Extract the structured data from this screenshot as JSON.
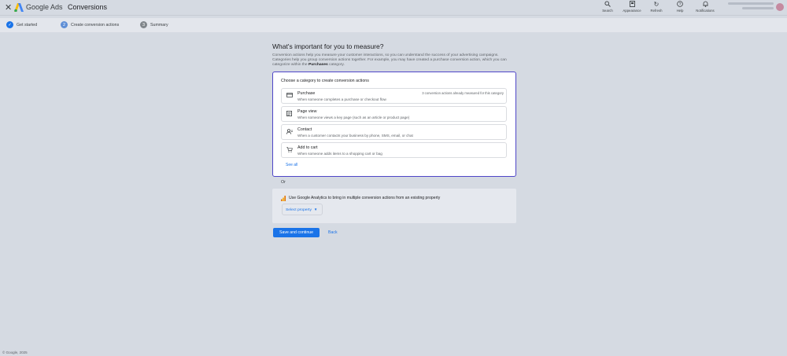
{
  "header": {
    "close_icon": "close-icon",
    "brand": "Google Ads",
    "page_title": "Conversions",
    "tools": [
      {
        "icon": "search-icon",
        "label": "Search"
      },
      {
        "icon": "appearance-icon",
        "label": "Appearance"
      },
      {
        "icon": "refresh-icon",
        "label": "Refresh"
      },
      {
        "icon": "help-icon",
        "label": "Help"
      },
      {
        "icon": "bell-icon",
        "label": "Notifications"
      }
    ]
  },
  "stepper": {
    "steps": [
      {
        "number": "✓",
        "label": "Get started",
        "state": "done"
      },
      {
        "number": "2",
        "label": "Create conversion actions",
        "state": "active"
      },
      {
        "number": "3",
        "label": "Summary",
        "state": "todo"
      }
    ]
  },
  "main": {
    "title": "What's important for you to measure?",
    "desc_part1": "Conversion actions help you measure your customer interactions, so you can understand the success of your advertising campaigns. Categories help you group conversion actions together. For example, you may have created a purchase conversion action, which you can categorize within the ",
    "desc_bold": "Purchases",
    "desc_part2": " category."
  },
  "category_card": {
    "title": "Choose a category to create conversion actions",
    "options": [
      {
        "icon": "credit-card-icon",
        "name": "Purchase",
        "desc": "When someone completes a purchase or checkout flow",
        "note": "3 conversion actions already measured for this category"
      },
      {
        "icon": "page-view-icon",
        "name": "Page view",
        "desc": "When someone views a key page (such as an article or product page)",
        "note": ""
      },
      {
        "icon": "contact-icon",
        "name": "Contact",
        "desc": "When a customer contacts your business by phone, SMS, email, or chat",
        "note": ""
      },
      {
        "icon": "add-to-cart-icon",
        "name": "Add to cart",
        "desc": "When someone adds items to a shopping cart or bag",
        "note": ""
      }
    ],
    "see_all": "See all"
  },
  "or_label": "Or",
  "analytics": {
    "icon": "google-analytics-icon",
    "text": "Use Google Analytics to bring in multiple conversion actions from an existing property",
    "select_label": "Select property"
  },
  "actions": {
    "save": "Save and continue",
    "back": "Back"
  },
  "footer": "© Google, 2025",
  "colors": {
    "accent": "#1a73e8",
    "card_border": "#4f46c8",
    "background": "#d5dae2"
  }
}
